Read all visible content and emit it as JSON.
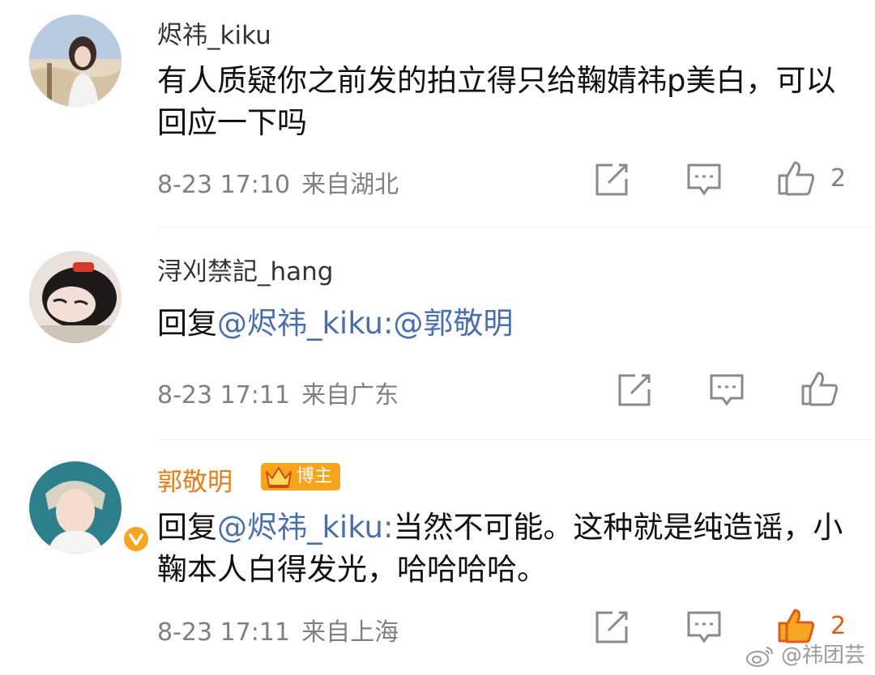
{
  "comments": [
    {
      "username": "烬祎_kiku",
      "text_plain": "有人质疑你之前发的拍立得只给鞠婧祎p美白，可以回应一下吗",
      "time": "8-23 17:10",
      "location": "来自湖北",
      "like_count": "2"
    },
    {
      "username": "浔刈禁記_hang",
      "reply_prefix": "回复",
      "reply_mention": "@烬祎_kiku:@郭敬明",
      "time": "8-23 17:11",
      "location": "来自广东",
      "like_count": ""
    },
    {
      "username": "郭敬明",
      "badge": "博主",
      "reply_prefix": "回复",
      "reply_mention": "@烬祎_kiku:",
      "reply_text": "当然不可能。这种就是纯造谣，小鞠本人白得发光，哈哈哈哈。",
      "time": "8-23 17:11",
      "location": "来自上海",
      "like_count": "2"
    }
  ],
  "icons": [
    "edit-icon",
    "comment-icon",
    "like-icon",
    "verified-icon",
    "crown-icon",
    "weibo-logo-icon"
  ],
  "colors": {
    "mention": "#4a6fae",
    "owner_name": "#e77b17",
    "badge": "#f7a41c",
    "liked": "#f5a623",
    "meta": "#808080"
  },
  "watermark": "@祎团芸"
}
